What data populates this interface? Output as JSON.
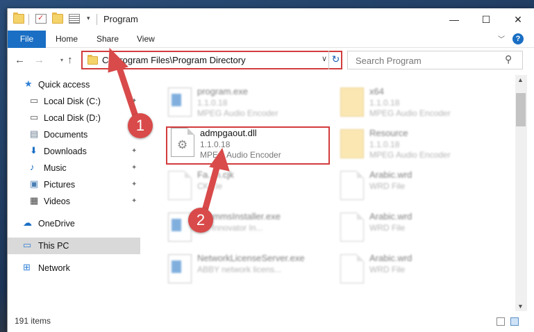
{
  "window": {
    "title": "Program"
  },
  "ribbon": {
    "tabs": [
      "File",
      "Home",
      "Share",
      "View"
    ]
  },
  "navigation": {
    "address": "C:\\Program Files\\Program Directory",
    "search_placeholder": "Search Program"
  },
  "sidebar": {
    "items": [
      {
        "label": "Quick access",
        "icon": "star-icon"
      },
      {
        "label": "Local Disk (C:)",
        "icon": "drive-icon"
      },
      {
        "label": "Local Disk (D:)",
        "icon": "drive-icon"
      },
      {
        "label": "Documents",
        "icon": "documents-icon"
      },
      {
        "label": "Downloads",
        "icon": "download-icon"
      },
      {
        "label": "Music",
        "icon": "music-icon"
      },
      {
        "label": "Pictures",
        "icon": "pictures-icon"
      },
      {
        "label": "Videos",
        "icon": "videos-icon"
      },
      {
        "label": "OneDrive",
        "icon": "cloud-icon"
      },
      {
        "label": "This PC",
        "icon": "computer-icon",
        "selected": true
      },
      {
        "label": "Network",
        "icon": "network-icon"
      }
    ]
  },
  "files": [
    {
      "name": "program.exe",
      "version": "1.1.0.18",
      "description": "MPEG Audio Encoder",
      "icon": "program-icon"
    },
    {
      "name": "x64",
      "version": "1.1.0.18",
      "description": "MPEG Audio Encoder",
      "icon": "folder-icon"
    },
    {
      "name": "admpgaout.dll",
      "version": "1.1.0.18",
      "description": "MPEG Audio Encoder",
      "icon": "dll-gear-icon",
      "highlighted": true
    },
    {
      "name": "Resource",
      "version": "1.1.0.18",
      "description": "MPEG Audio Encoder",
      "icon": "folder-icon"
    },
    {
      "name": "Fa...n.cjk",
      "version": "CK...le",
      "description": "",
      "icon": "document-icon"
    },
    {
      "name": "Arabic.wrd",
      "version": "WRD File",
      "description": "",
      "icon": "document-icon"
    },
    {
      "name": "...rammsInstaller.exe",
      "version": "...Y Innovator In...",
      "description": "",
      "icon": "installer-icon"
    },
    {
      "name": "Arabic.wrd",
      "version": "WRD File",
      "description": "",
      "icon": "document-icon"
    },
    {
      "name": "NetworkLicenseServer.exe",
      "version": "ABBY network licens...",
      "description": "",
      "icon": "app-icon"
    },
    {
      "name": "Arabic.wrd",
      "version": "WRD File",
      "description": "",
      "icon": "document-icon"
    }
  ],
  "status": {
    "item_count": "191 items"
  },
  "annotations": {
    "step1": "1",
    "step2": "2"
  },
  "colors": {
    "accent": "#1a6fc4",
    "highlight": "#d23c3c",
    "badge": "#d94a4a"
  }
}
